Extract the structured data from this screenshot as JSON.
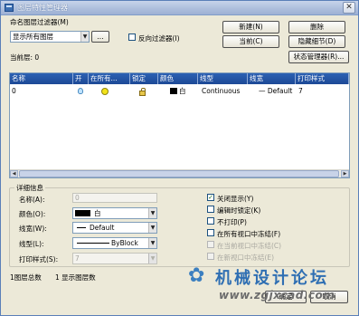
{
  "window": {
    "title": "图层特性管理器"
  },
  "filter": {
    "section_label": "命名图层过滤器(M)",
    "selected": "显示所有图层",
    "browse_label": "...",
    "invert_label": "反向过滤器(I)"
  },
  "current_layer": {
    "label": "当前层: 0"
  },
  "buttons": {
    "new": "新建(N)",
    "delete": "删除",
    "current": "当前(C)",
    "hide_details": "隐藏细节(D)",
    "state_manager": "状态管理器(R)..."
  },
  "table": {
    "columns": [
      "名称",
      "开",
      "在所有...",
      "锁定",
      "颜色",
      "线型",
      "线宽",
      "打印样式"
    ],
    "rows": [
      {
        "name": "0",
        "color": "白",
        "linetype": "Continuous",
        "lineweight": "— Default",
        "plotstyle": "7"
      }
    ]
  },
  "details": {
    "title": "详细信息",
    "name_label": "名称(A):",
    "name_value": "0",
    "color_label": "颜色(O):",
    "color_value": "白",
    "lineweight_label": "线宽(W):",
    "lineweight_value": "Default",
    "linetype_label": "线型(L):",
    "linetype_value": "ByBlock",
    "plotstyle_label": "打印样式(S):",
    "plotstyle_value": "7",
    "options": [
      {
        "label": "关闭显示(Y)",
        "checked": true,
        "enabled": true
      },
      {
        "label": "编辑时锁定(K)",
        "checked": false,
        "enabled": true
      },
      {
        "label": "不打印(P)",
        "checked": false,
        "enabled": true
      },
      {
        "label": "在所有视口中冻结(F)",
        "checked": false,
        "enabled": true
      },
      {
        "label": "在当前视口中冻结(C)",
        "checked": false,
        "enabled": false
      },
      {
        "label": "在新视口中冻结(E)",
        "checked": false,
        "enabled": false
      }
    ]
  },
  "status": {
    "total": "1图层总数",
    "shown": "1 显示图层数"
  },
  "footer_buttons": {
    "ok": "确定",
    "cancel": "取消"
  },
  "watermark": {
    "name": "机械设计论坛",
    "url": "www.zgjxcad.com"
  },
  "colors": {
    "header_blue": "#1d4996",
    "title_bar": "#aebfdd",
    "dialog_bg": "#ece9d8"
  }
}
